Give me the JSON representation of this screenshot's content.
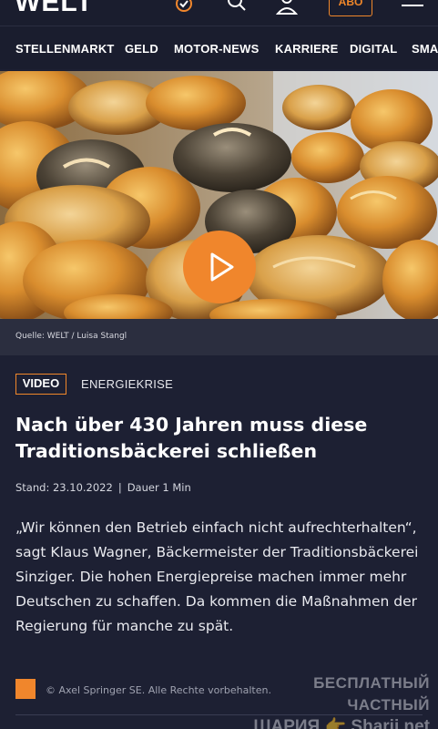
{
  "header": {
    "logo": "WELT",
    "abo_label": "ABO",
    "icons": [
      "weather-icon",
      "search-icon",
      "user-icon",
      "menu-icon"
    ]
  },
  "nav": {
    "items": [
      "STELLENMARKT",
      "GELD",
      "MOTOR-NEWS",
      "KARRIERE",
      "DIGITAL",
      "SMA"
    ]
  },
  "media": {
    "caption": "Quelle: WELT / Luisa Stangl"
  },
  "article": {
    "badge": "VIDEO",
    "topic": "ENERGIEKRISE",
    "headline": "Nach über 430 Jahren muss diese Traditionsbäckerei schließen",
    "date": "Stand: 23.10.2022",
    "separator": "|",
    "duration": "Dauer 1 Min",
    "body": "„Wir können den Betrieb einfach nicht aufrechterhalten“, sagt Klaus Wagner, Bäckermeister der Traditionsbäckerei Sinziger. Die hohen Energiepreise machen immer mehr Deutschen zu schaffen. Da kommen die Maßnahmen der Regierung für manche zu spät."
  },
  "footer": {
    "copyright": "© Axel Springer SE. Alle Rechte vorbehalten."
  },
  "watermark": {
    "line1": "БЕСПЛАТНЫЙ ЧАСТНЫЙ",
    "line2": "ШАРИЯ 👉 Sharij.net"
  },
  "colors": {
    "background": "#1d2033",
    "accent": "#f0862c",
    "nav_background": "#1a1d2e"
  }
}
